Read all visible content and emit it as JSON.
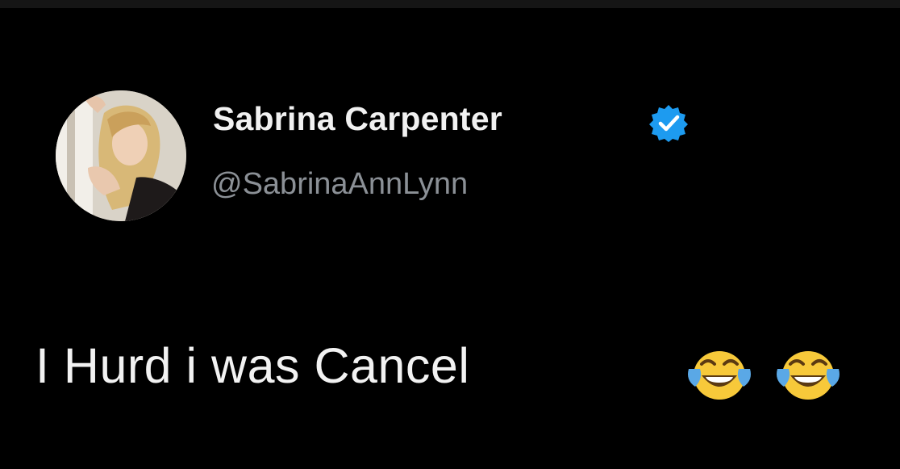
{
  "tweet": {
    "author": {
      "name": "Sabrina Carpenter",
      "handle": "@SabrinaAnnLynn",
      "verified": true,
      "verified_color": "#1d9bf0"
    },
    "text": "I Hurd i was Cancel",
    "emojis": [
      "face-with-tears-of-joy",
      "face-with-tears-of-joy"
    ]
  },
  "colors": {
    "background": "#000000",
    "name": "#f1f1f1",
    "handle": "#8b9096",
    "text": "#f2f2f2",
    "emoji_face": "#f7c93a",
    "emoji_tears": "#5aa8e6"
  }
}
